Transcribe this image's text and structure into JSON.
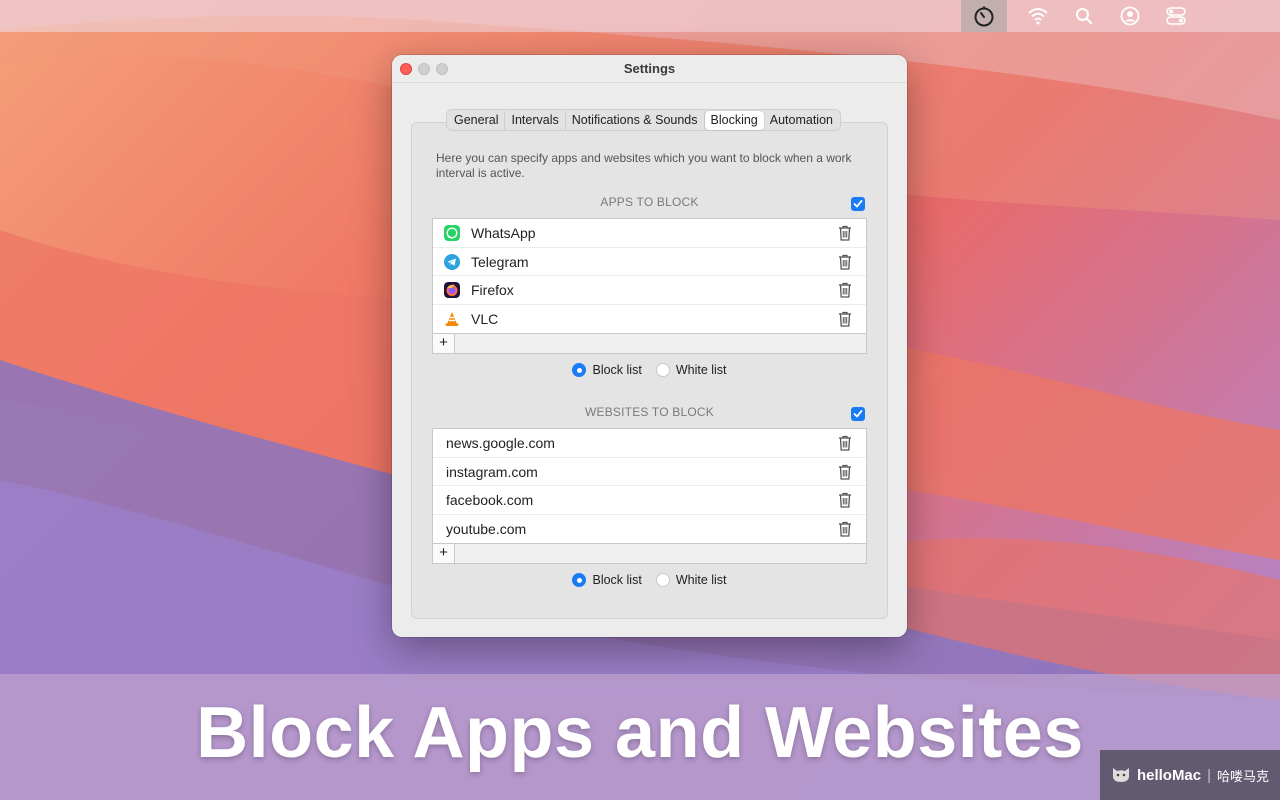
{
  "window": {
    "title": "Settings"
  },
  "tabs": [
    {
      "label": "General"
    },
    {
      "label": "Intervals"
    },
    {
      "label": "Notifications & Sounds"
    },
    {
      "label": "Blocking",
      "selected": true
    },
    {
      "label": "Automation"
    }
  ],
  "description": "Here you can specify apps and websites which you want to block when a work interval is active.",
  "apps": {
    "title": "APPS TO BLOCK",
    "enabled": true,
    "items": [
      {
        "label": "WhatsApp",
        "icon": "whatsapp-icon"
      },
      {
        "label": "Telegram",
        "icon": "telegram-icon"
      },
      {
        "label": "Firefox",
        "icon": "firefox-icon"
      },
      {
        "label": "VLC",
        "icon": "vlc-icon"
      }
    ],
    "add_label": "+",
    "mode_options": [
      "Block list",
      "White list"
    ],
    "mode_selected": "Block list"
  },
  "websites": {
    "title": "WEBSITES TO BLOCK",
    "enabled": true,
    "items": [
      {
        "label": "news.google.com"
      },
      {
        "label": "instagram.com"
      },
      {
        "label": "facebook.com"
      },
      {
        "label": "youtube.com"
      }
    ],
    "add_label": "+",
    "mode_options": [
      "Block list",
      "White list"
    ],
    "mode_selected": "Block list"
  },
  "banner": {
    "title": "Block Apps and Websites"
  },
  "watermark": {
    "brand": "helloMac",
    "cn": "哈喽马克"
  },
  "colors": {
    "accent": "#1a7cf5",
    "close": "#fe5f57"
  }
}
